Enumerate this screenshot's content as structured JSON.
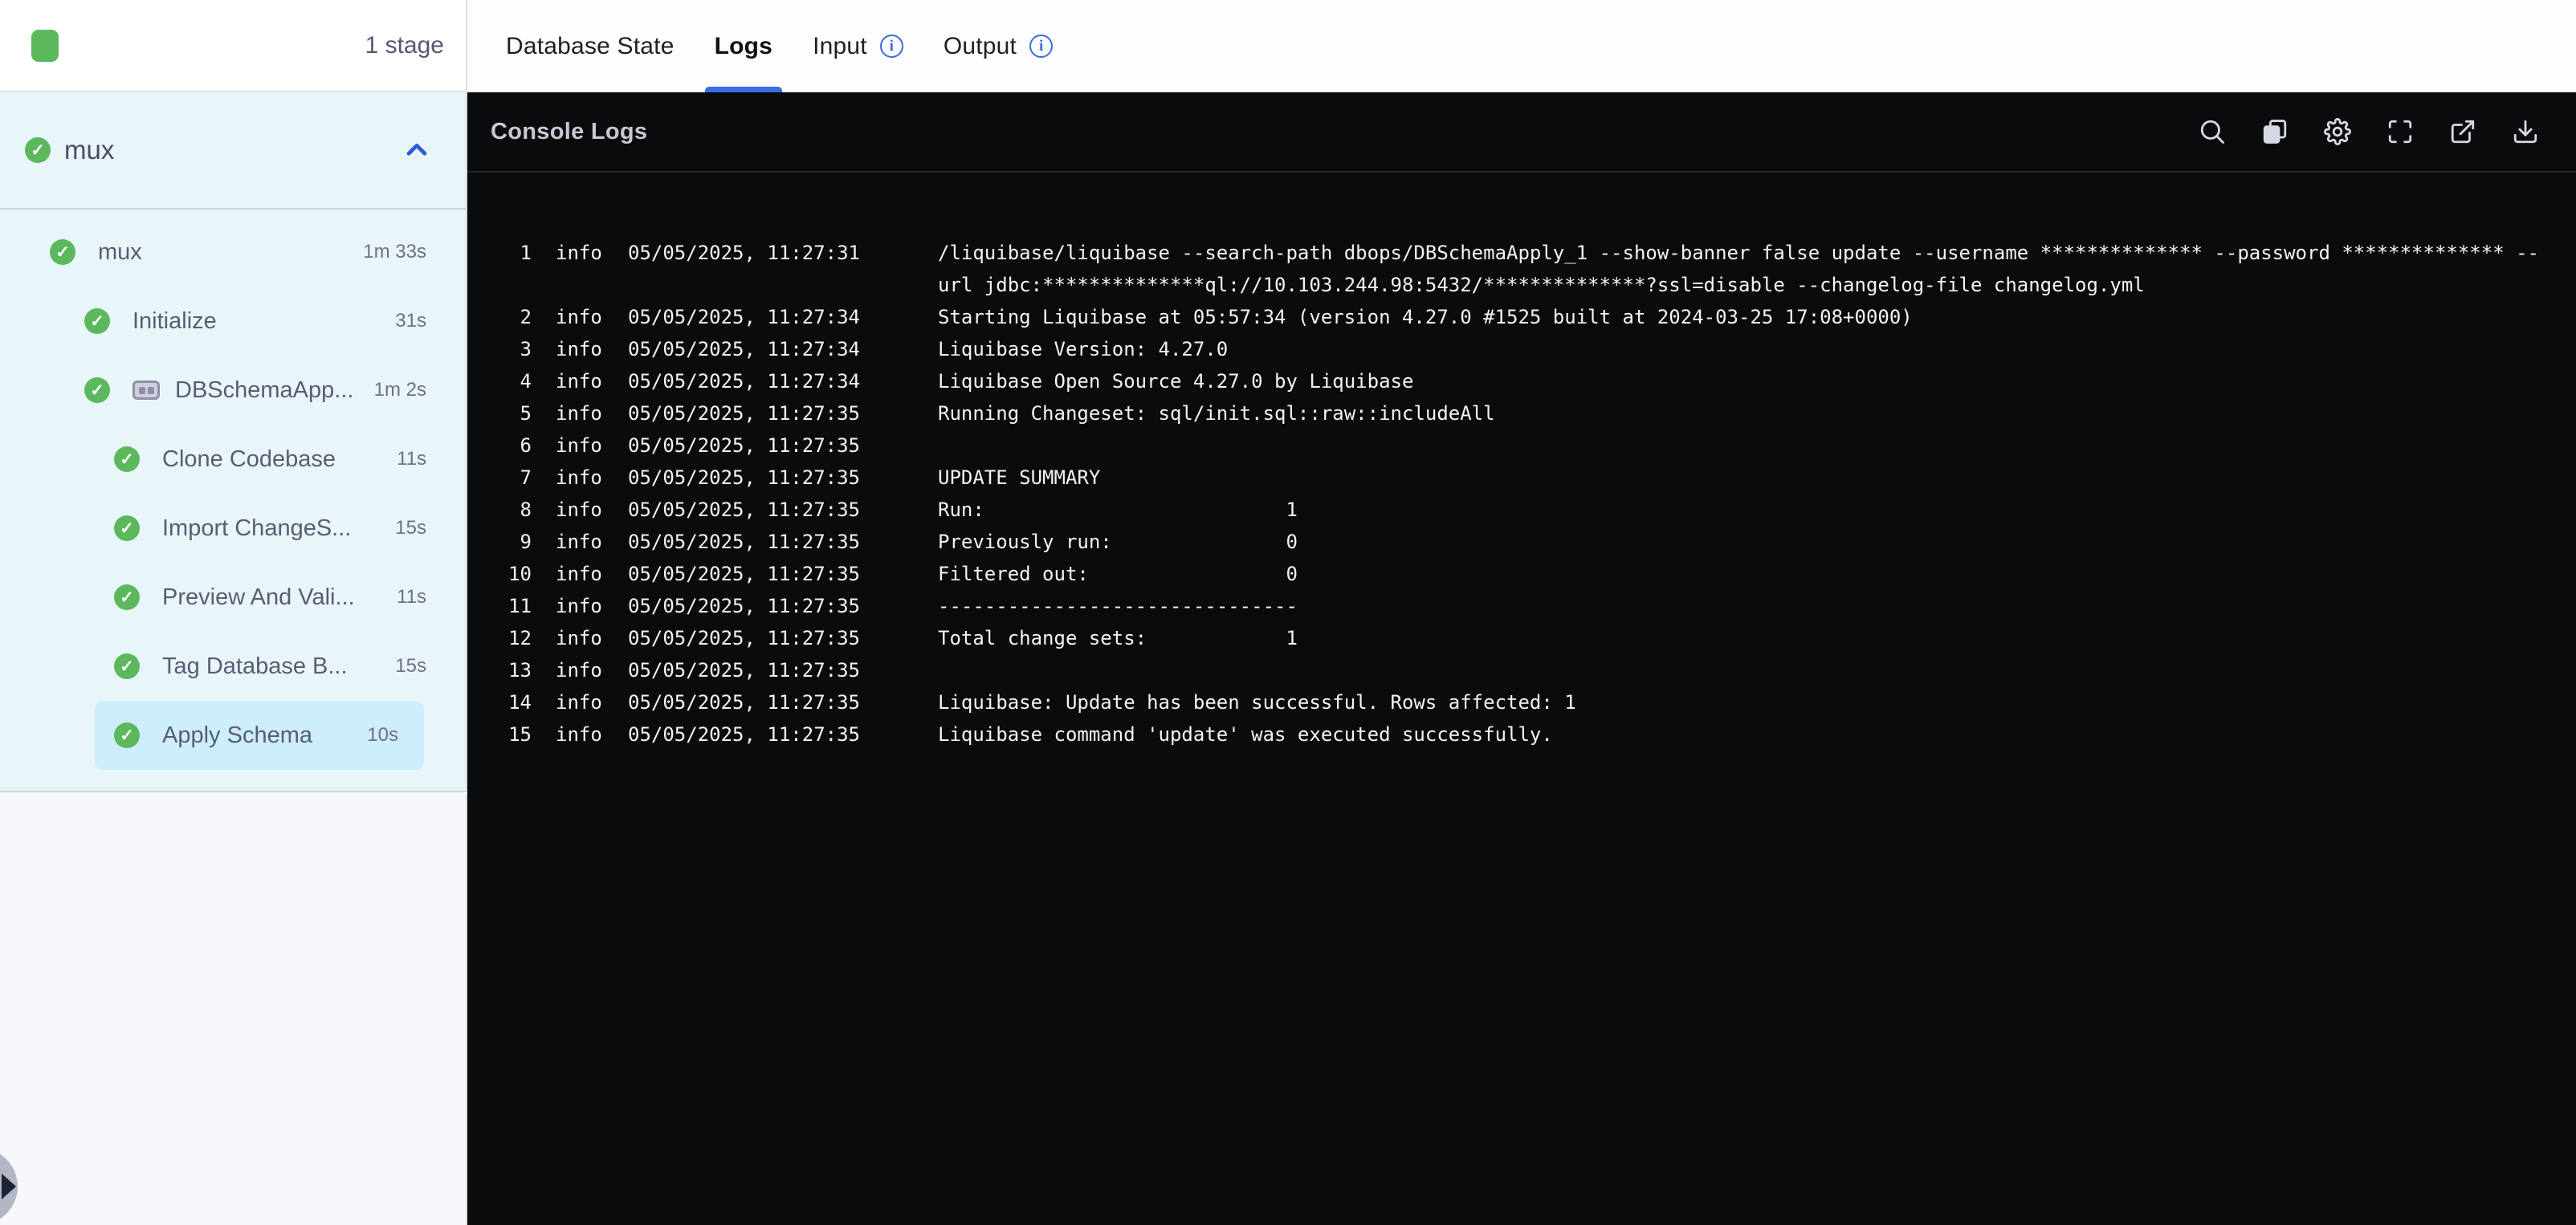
{
  "colors": {
    "accent_blue": "#3a6ce2",
    "success_green": "#5cb85c",
    "selected_highlight": "#cdeefd",
    "console_background": "#0a0b0d",
    "sidebar_background": "#e9f6f9"
  },
  "header": {
    "stage_count_label": "1 stage"
  },
  "tabs": [
    {
      "label": "Database State",
      "active": false,
      "has_info": false
    },
    {
      "label": "Logs",
      "active": true,
      "has_info": false
    },
    {
      "label": "Input",
      "active": false,
      "has_info": true
    },
    {
      "label": "Output",
      "active": false,
      "has_info": true
    }
  ],
  "sidebar": {
    "stage_group": {
      "label": "mux",
      "status": "success",
      "collapse_icon": "chevron-up-icon"
    },
    "tree": [
      {
        "label": "mux",
        "duration": "1m 33s",
        "level": 1,
        "status": "success",
        "selected": false
      },
      {
        "label": "Initialize",
        "duration": "31s",
        "level": 2,
        "status": "success",
        "selected": false
      },
      {
        "label": "DBSchemaApp...",
        "duration": "1m 2s",
        "level": 2,
        "status": "success",
        "icon": "step-group-icon",
        "selected": false
      },
      {
        "label": "Clone Codebase",
        "duration": "11s",
        "level": 3,
        "status": "success",
        "selected": false
      },
      {
        "label": "Import ChangeS...",
        "duration": "15s",
        "level": 3,
        "status": "success",
        "selected": false
      },
      {
        "label": "Preview And Vali...",
        "duration": "11s",
        "level": 3,
        "status": "success",
        "selected": false
      },
      {
        "label": "Tag Database B...",
        "duration": "15s",
        "level": 3,
        "status": "success",
        "selected": false
      },
      {
        "label": "Apply Schema",
        "duration": "10s",
        "level": 3,
        "status": "success",
        "selected": true
      }
    ]
  },
  "console": {
    "title": "Console Logs",
    "toolbar_icons": [
      "search",
      "copy",
      "settings",
      "fullscreen",
      "open-in-new",
      "download"
    ],
    "logs": [
      {
        "n": "1",
        "level": "info",
        "time": "05/05/2025, 11:27:31",
        "message": "/liquibase/liquibase --search-path dbops/DBSchemaApply_1 --show-banner false update --username ************** --password ************** --url jdbc:**************ql://10.103.244.98:5432/**************?ssl=disable --changelog-file changelog.yml"
      },
      {
        "n": "2",
        "level": "info",
        "time": "05/05/2025, 11:27:34",
        "message": "Starting Liquibase at 05:57:34 (version 4.27.0 #1525 built at 2024-03-25 17:08+0000)"
      },
      {
        "n": "3",
        "level": "info",
        "time": "05/05/2025, 11:27:34",
        "message": "Liquibase Version: 4.27.0"
      },
      {
        "n": "4",
        "level": "info",
        "time": "05/05/2025, 11:27:34",
        "message": "Liquibase Open Source 4.27.0 by Liquibase"
      },
      {
        "n": "5",
        "level": "info",
        "time": "05/05/2025, 11:27:35",
        "message": "Running Changeset: sql/init.sql::raw::includeAll"
      },
      {
        "n": "6",
        "level": "info",
        "time": "05/05/2025, 11:27:35",
        "message": ""
      },
      {
        "n": "7",
        "level": "info",
        "time": "05/05/2025, 11:27:35",
        "message": "UPDATE SUMMARY"
      },
      {
        "n": "8",
        "level": "info",
        "time": "05/05/2025, 11:27:35",
        "message": "Run:                          1"
      },
      {
        "n": "9",
        "level": "info",
        "time": "05/05/2025, 11:27:35",
        "message": "Previously run:               0"
      },
      {
        "n": "10",
        "level": "info",
        "time": "05/05/2025, 11:27:35",
        "message": "Filtered out:                 0"
      },
      {
        "n": "11",
        "level": "info",
        "time": "05/05/2025, 11:27:35",
        "message": "-------------------------------"
      },
      {
        "n": "12",
        "level": "info",
        "time": "05/05/2025, 11:27:35",
        "message": "Total change sets:            1"
      },
      {
        "n": "13",
        "level": "info",
        "time": "05/05/2025, 11:27:35",
        "message": ""
      },
      {
        "n": "14",
        "level": "info",
        "time": "05/05/2025, 11:27:35",
        "message": "Liquibase: Update has been successful. Rows affected: 1"
      },
      {
        "n": "15",
        "level": "info",
        "time": "05/05/2025, 11:27:35",
        "message": "Liquibase command 'update' was executed successfully."
      }
    ]
  },
  "floating_button": {
    "icon": "play-icon"
  }
}
